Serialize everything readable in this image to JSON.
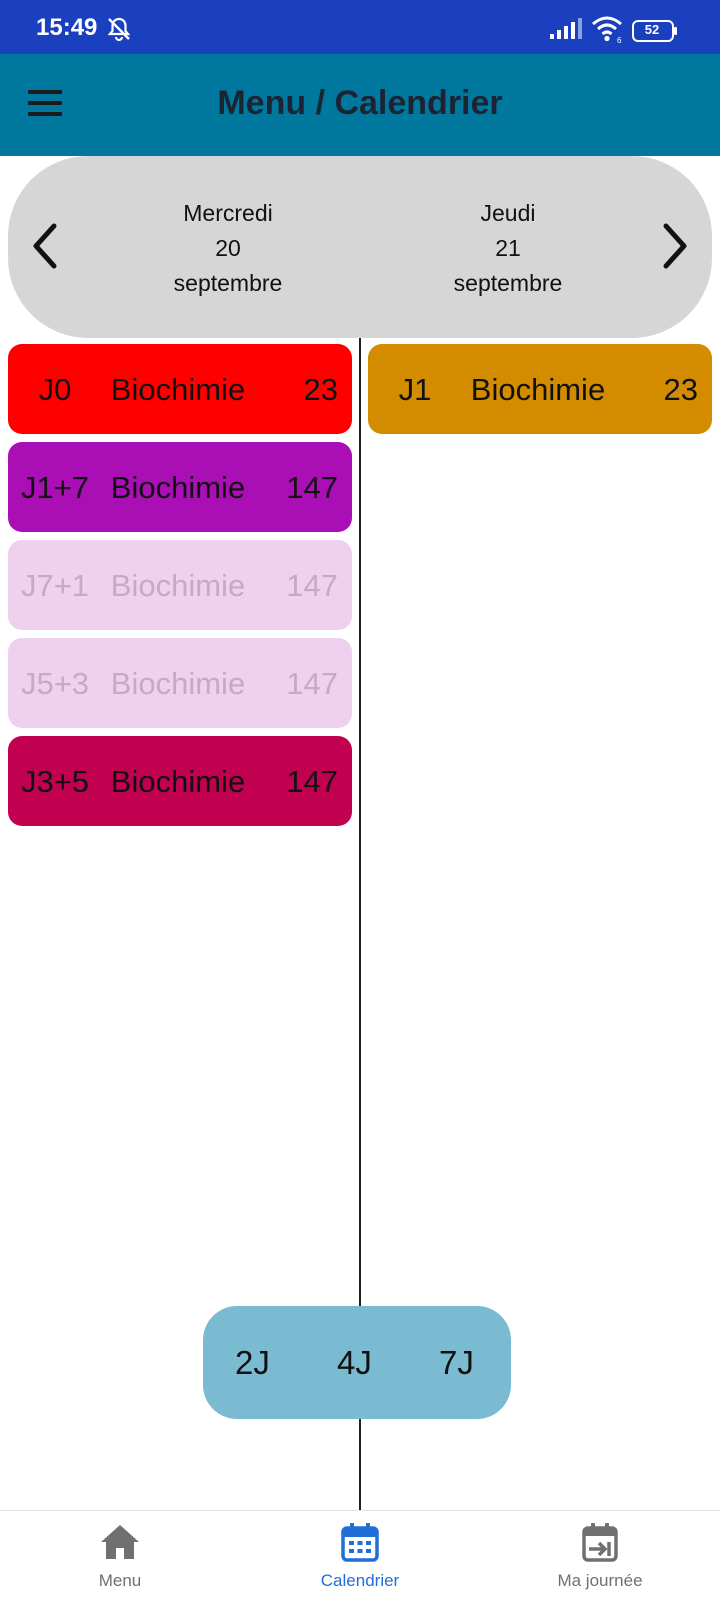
{
  "status_bar": {
    "time": "15:49",
    "battery": "52",
    "icons": [
      "mute-bell-icon",
      "signal-icon",
      "wifi-icon",
      "battery-icon"
    ]
  },
  "app_bar": {
    "title": "Menu / Calendrier",
    "menu_icon": "hamburger-menu-icon"
  },
  "date_header": {
    "prev_icon": "chevron-left-icon",
    "next_icon": "chevron-right-icon",
    "days": [
      {
        "weekday": "Mercredi",
        "day": "20",
        "month": "septembre"
      },
      {
        "weekday": "Jeudi",
        "day": "21",
        "month": "septembre"
      }
    ]
  },
  "columns": [
    {
      "events": [
        {
          "code": "J0",
          "name": "Biochimie",
          "number": "23",
          "color": "#ff0000"
        },
        {
          "code": "J1+7",
          "name": "Biochimie",
          "number": "147",
          "color": "#aa0eb5"
        },
        {
          "code": "J7+1",
          "name": "Biochimie",
          "number": "147",
          "color": "#f0d0ef",
          "faded": true
        },
        {
          "code": "J5+3",
          "name": "Biochimie",
          "number": "147",
          "color": "#f0d0ef",
          "faded": true
        },
        {
          "code": "J3+5",
          "name": "Biochimie",
          "number": "147",
          "color": "#c1004f"
        }
      ]
    },
    {
      "events": [
        {
          "code": "J1",
          "name": "Biochimie",
          "number": "23",
          "color": "#d38c00"
        }
      ]
    }
  ],
  "view_switcher": {
    "options": [
      "2J",
      "4J",
      "7J"
    ],
    "color": "#7abbd1"
  },
  "bottom_nav": {
    "items": [
      {
        "label": "Menu",
        "icon": "home-icon",
        "active": false
      },
      {
        "label": "Calendrier",
        "icon": "calendar-icon",
        "active": true
      },
      {
        "label": "Ma journée",
        "icon": "calendar-arrow-icon",
        "active": false
      }
    ],
    "active_color": "#1f6fd6"
  },
  "colors": {
    "status_bar": "#1a3fbf",
    "app_bar": "#00779c",
    "date_header": "#d6d6d6"
  }
}
